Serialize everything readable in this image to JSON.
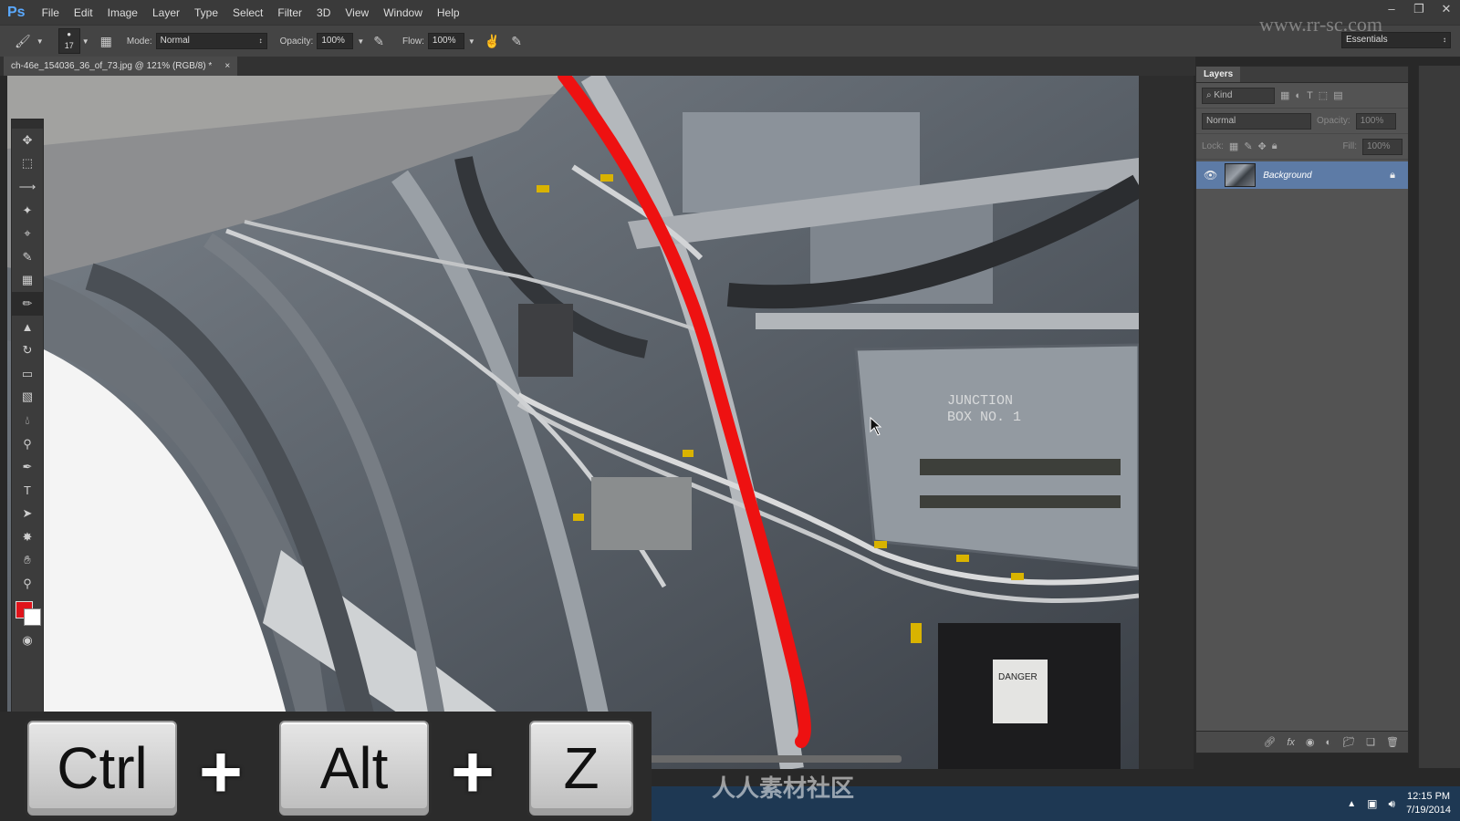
{
  "app": {
    "logo": "Ps"
  },
  "menubar": {
    "items": [
      "File",
      "Edit",
      "Image",
      "Layer",
      "Type",
      "Select",
      "Filter",
      "3D",
      "View",
      "Window",
      "Help"
    ]
  },
  "window_controls": [
    "–",
    "❐",
    "✕"
  ],
  "options_bar": {
    "brush_size": "17",
    "mode_label": "Mode:",
    "mode_value": "Normal",
    "opacity_label": "Opacity:",
    "opacity_value": "100%",
    "flow_label": "Flow:",
    "flow_value": "100%",
    "workspace": "Essentials"
  },
  "document": {
    "tab_title": "ch-46e_154036_36_of_73.jpg @ 121% (RGB/8) *",
    "close": "×"
  },
  "photo_labels": {
    "junction": "JUNCTION\nBOX NO. 1",
    "danger": "DANGER"
  },
  "layers_panel": {
    "title": "Layers",
    "kind_filter": "⌕ Kind",
    "blend_mode": "Normal",
    "opacity_label": "Opacity:",
    "opacity_value": "100%",
    "lock_label": "Lock:",
    "fill_label": "Fill:",
    "fill_value": "100%",
    "layers": [
      {
        "name": "Background",
        "locked": true,
        "visible": true
      }
    ],
    "footer_icons": [
      "link-icon",
      "fx-icon",
      "mask-icon",
      "adjustment-icon",
      "group-folder-icon",
      "new-layer-icon",
      "trash-icon"
    ]
  },
  "colors": {
    "foreground": "#e0141b",
    "background": "#ffffff",
    "brush_stroke": "#ee1111",
    "selection": "#5d7ba6"
  },
  "keys_overlay": {
    "key1": "Ctrl",
    "plus": "+",
    "key2": "Alt",
    "key3": "Z"
  },
  "watermark": {
    "url": "www.rr-sc.com",
    "text": "人人素材社区"
  },
  "taskbar": {
    "time": "12:15 PM",
    "date": "7/19/2014"
  }
}
